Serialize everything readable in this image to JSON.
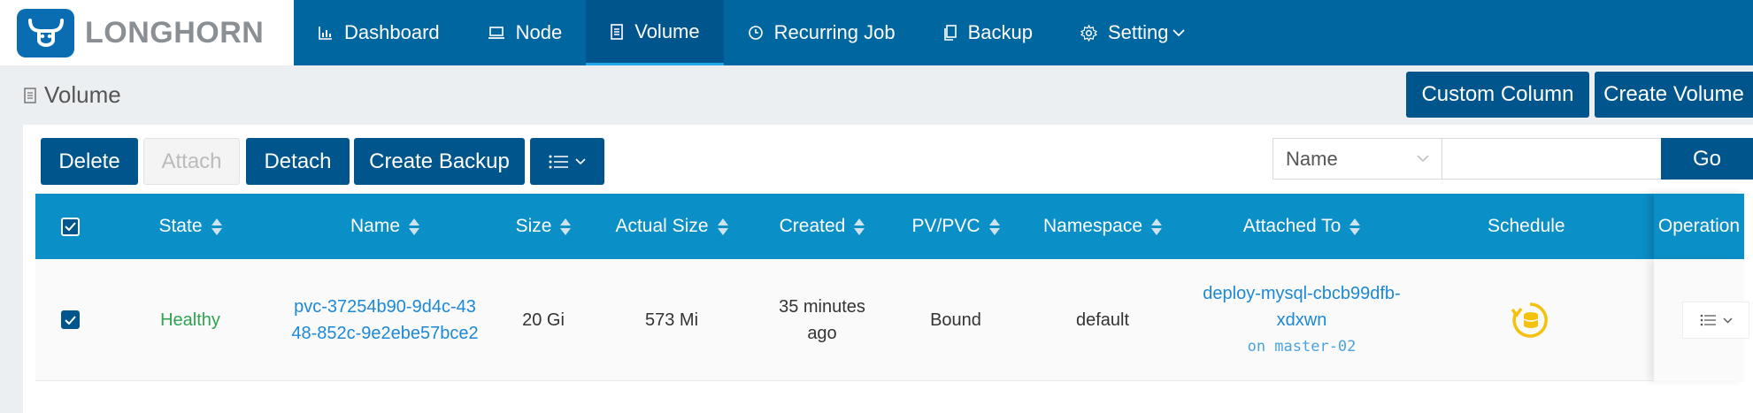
{
  "app": {
    "name": "LONGHORN"
  },
  "nav": [
    {
      "label": "Dashboard",
      "icon": "bar-chart-icon"
    },
    {
      "label": "Node",
      "icon": "laptop-icon"
    },
    {
      "label": "Volume",
      "icon": "volume-icon",
      "active": true
    },
    {
      "label": "Recurring Job",
      "icon": "clock-icon"
    },
    {
      "label": "Backup",
      "icon": "copy-icon"
    },
    {
      "label": "Setting",
      "icon": "gear-icon"
    }
  ],
  "page": {
    "title": "Volume"
  },
  "header_buttons": {
    "custom_column": "Custom Column",
    "create_volume": "Create Volume"
  },
  "toolbar": {
    "delete": "Delete",
    "attach": "Attach",
    "detach": "Detach",
    "create_backup": "Create Backup"
  },
  "search": {
    "field": "Name",
    "value": "",
    "go": "Go"
  },
  "table": {
    "columns": [
      "State",
      "Name",
      "Size",
      "Actual Size",
      "Created",
      "PV/PVC",
      "Namespace",
      "Attached To",
      "Schedule",
      "Operation"
    ],
    "rows": [
      {
        "state": "Healthy",
        "name_line1": "pvc-37254b90-9d4c-43",
        "name_line2": "48-852c-9e2ebe57bce2",
        "size": "20 Gi",
        "actual_size": "573 Mi",
        "created_line1": "35 minutes",
        "created_line2": "ago",
        "pv_pvc": "Bound",
        "namespace": "default",
        "attached_line1": "deploy-mysql-cbcb99dfb-",
        "attached_line2": "xdxwn",
        "attached_node": "on master-02"
      }
    ]
  },
  "colors": {
    "nav_bg": "#0066a0",
    "primary": "#00558c",
    "table_header": "#0b8fc7",
    "healthy": "#2ea44f",
    "link": "#1c88d6"
  }
}
